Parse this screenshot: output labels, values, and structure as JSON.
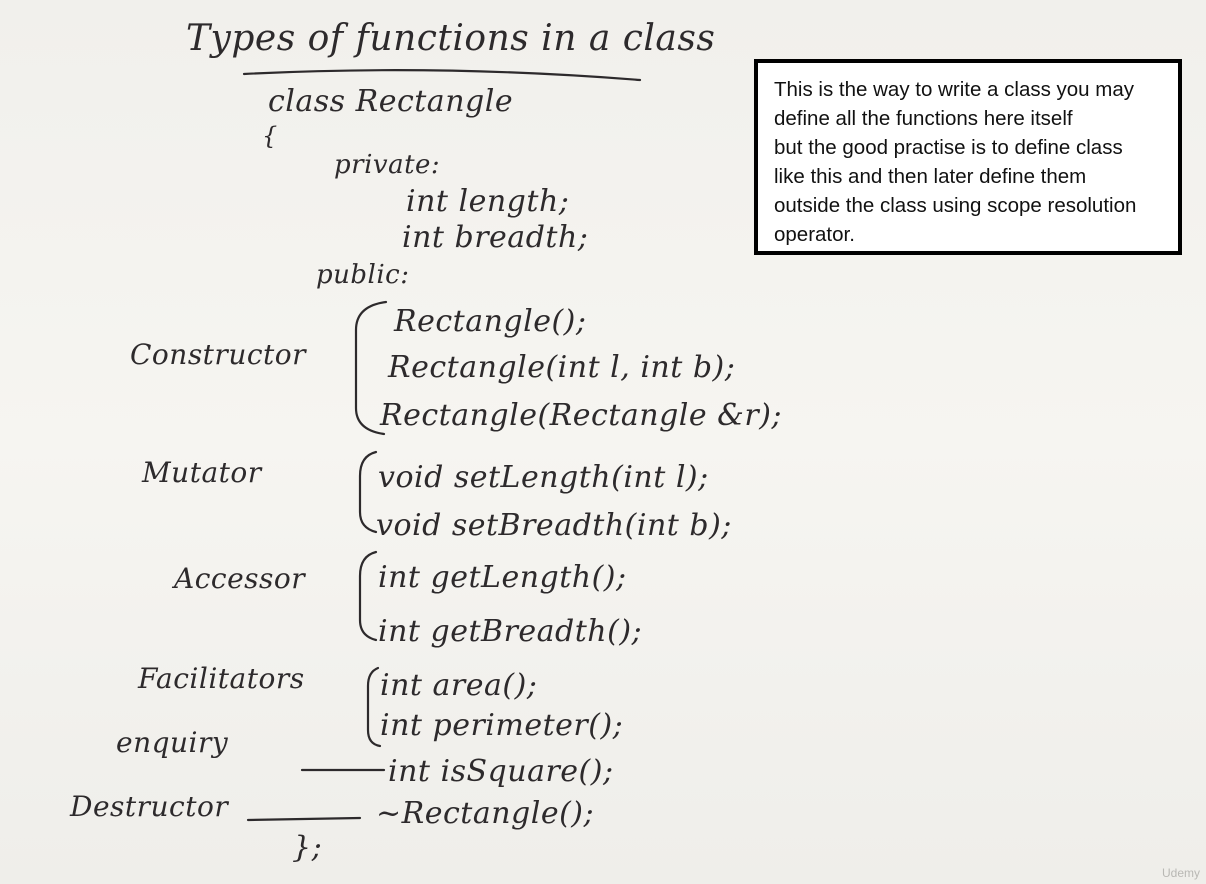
{
  "board": {
    "title": "Types of functions in a class",
    "code": {
      "class_decl": "class Rectangle",
      "open_brace": "{",
      "private": "private:",
      "field_length": "int length;",
      "field_breadth": "int breadth;",
      "public": "public:",
      "ctor1": "Rectangle();",
      "ctor2": "Rectangle(int l, int b);",
      "ctor3": "Rectangle(Rectangle &r);",
      "mut1": "void setLength(int l);",
      "mut2": "void setBreadth(int b);",
      "acc1": "int getLength();",
      "acc2": "int getBreadth();",
      "fac1": "int area();",
      "fac2": "int perimeter();",
      "enq": "int isSquare();",
      "dtor": "~Rectangle();",
      "close_brace": "};"
    },
    "labels": {
      "constructor": "Constructor",
      "mutator": "Mutator",
      "accessor": "Accessor",
      "facilitators": "Facilitators",
      "enquiry": "enquiry",
      "destructor": "Destructor"
    }
  },
  "note": {
    "text": "This is the way to write a class you may\ndefine all the functions here itself\nbut the good practise is to define class\nlike this and then later define them\noutside the class using scope resolution\noperator."
  },
  "watermark": "Udemy",
  "colors": {
    "ink": "#2d2a2c",
    "board": "#f3f2ee",
    "note_border": "#000000"
  }
}
